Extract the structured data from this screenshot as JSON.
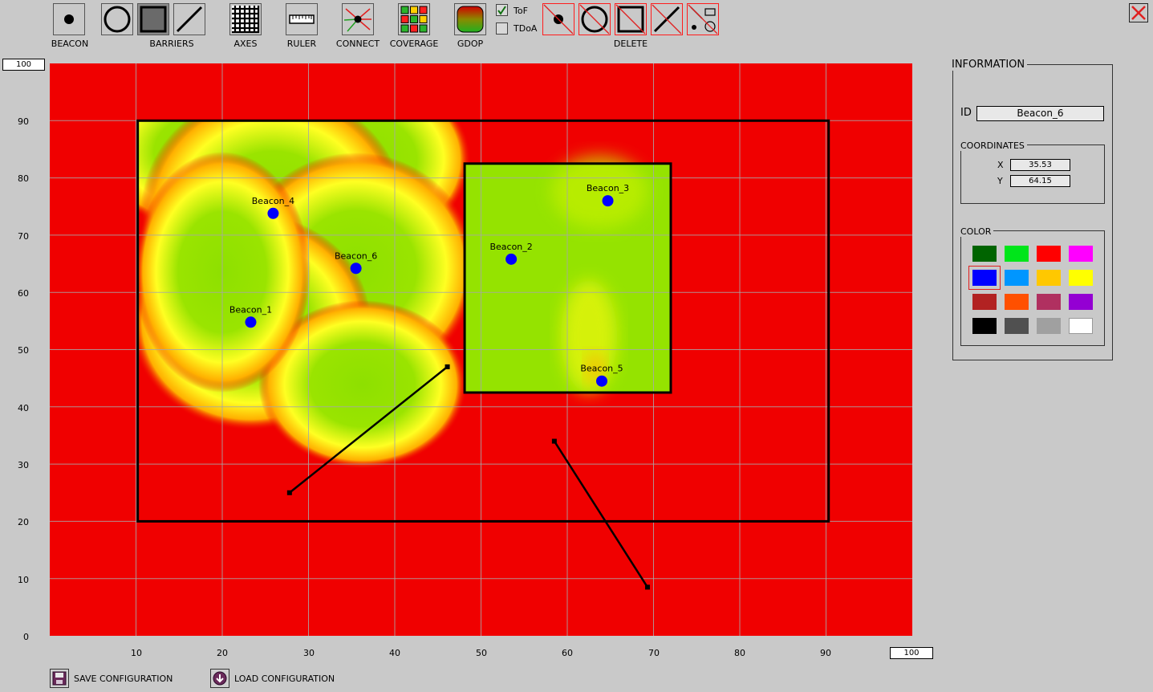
{
  "toolbar": {
    "labels": {
      "beacon": "BEACON",
      "barriers": "BARRIERS",
      "axes": "AXES",
      "ruler": "RULER",
      "connect": "CONNECT",
      "coverage": "COVERAGE",
      "gdop": "GDOP",
      "delete": "DELETE"
    },
    "tof": {
      "label": "ToF",
      "checked": true
    },
    "tdoa": {
      "label": "TDoA",
      "checked": false
    },
    "pressed_tool": "barriers-rectangle"
  },
  "axis": {
    "y_max_box": "100",
    "x_max_box": "100",
    "y_ticks": [
      "90",
      "80",
      "70",
      "60",
      "50",
      "40",
      "30",
      "20",
      "10",
      "0"
    ],
    "x_ticks": [
      "10",
      "20",
      "30",
      "40",
      "50",
      "60",
      "70",
      "80",
      "90"
    ],
    "xlim": [
      0,
      100
    ],
    "ylim": [
      0,
      100
    ],
    "grid": true
  },
  "map": {
    "beacons": [
      {
        "name": "Beacon_1",
        "x": 23.3,
        "y": 54.8
      },
      {
        "name": "Beacon_2",
        "x": 53.5,
        "y": 65.8
      },
      {
        "name": "Beacon_3",
        "x": 64.7,
        "y": 76.0
      },
      {
        "name": "Beacon_4",
        "x": 25.9,
        "y": 73.8
      },
      {
        "name": "Beacon_5",
        "x": 64.0,
        "y": 44.5
      },
      {
        "name": "Beacon_6",
        "x": 35.5,
        "y": 64.2
      }
    ],
    "rect_barriers": [
      {
        "x1": 10.2,
        "y1": 20.0,
        "x2": 90.3,
        "y2": 90.0
      },
      {
        "x1": 48.1,
        "y1": 42.5,
        "x2": 72.0,
        "y2": 82.5
      }
    ],
    "line_barriers": [
      {
        "x1": 27.8,
        "y1": 25.0,
        "x2": 46.1,
        "y2": 47.0
      },
      {
        "x1": 58.5,
        "y1": 34.0,
        "x2": 69.3,
        "y2": 8.5
      }
    ],
    "beacon_color": "#0000ff",
    "coverage_colors": {
      "none": "#f00000",
      "weak": "#ffff22",
      "good": "#8ee000"
    }
  },
  "info": {
    "title": "INFORMATION",
    "id_label": "ID",
    "id_value": "Beacon_6",
    "coordinates_label": "COORDINATES",
    "x_label": "X",
    "x_value": "35.53",
    "y_label": "Y",
    "y_value": "64.15",
    "color_label": "COLOR",
    "palette": [
      "#006400",
      "#00e51a",
      "#ff0000",
      "#ff00ff",
      "#0000ff",
      "#0096ff",
      "#ffc800",
      "#ffff00",
      "#b22222",
      "#ff5000",
      "#b03060",
      "#9400d3",
      "#000000",
      "#505050",
      "#a0a0a0",
      "#ffffff"
    ],
    "selected_color_index": 4
  },
  "bottom": {
    "save_label": "SAVE CONFIGURATION",
    "load_label": "LOAD CONFIGURATION"
  }
}
